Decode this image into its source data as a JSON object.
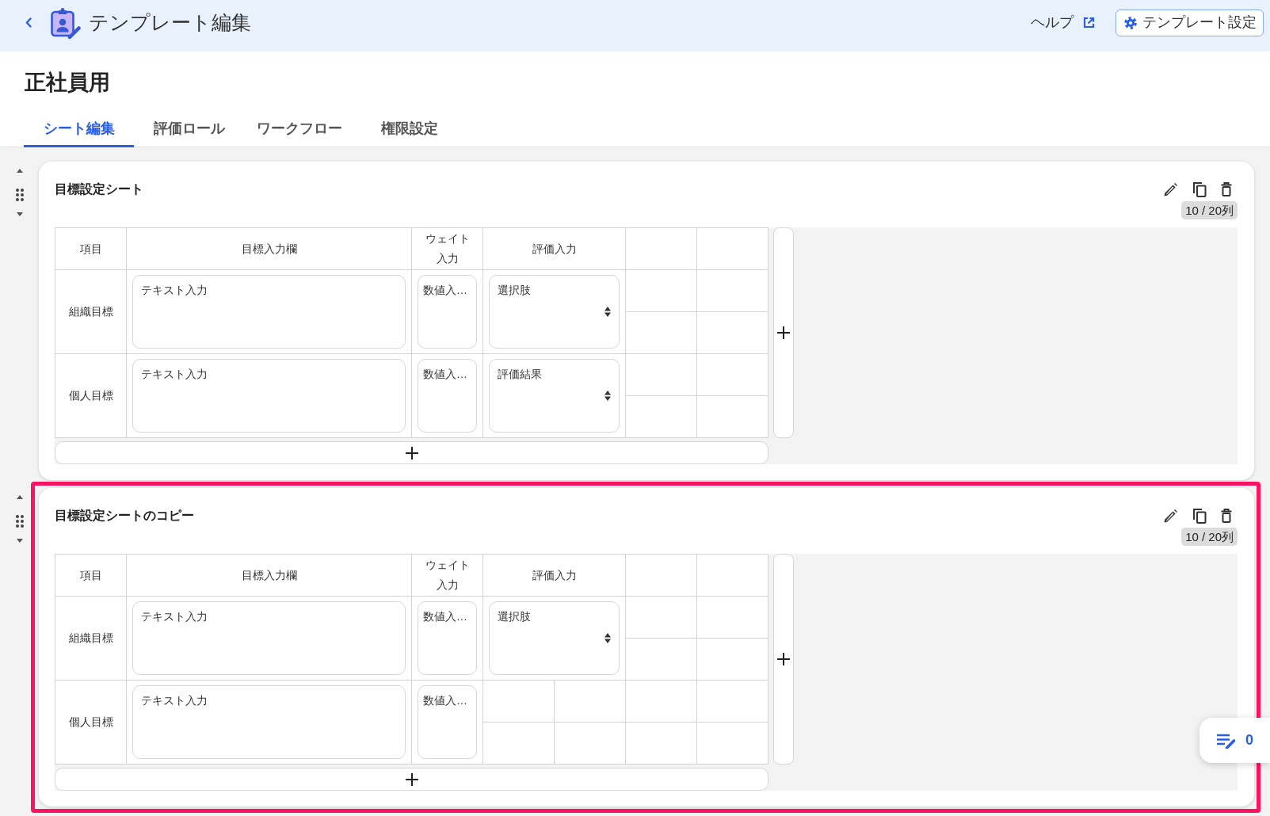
{
  "header": {
    "title": "テンプレート編集",
    "help_link": "ヘルプ",
    "settings_button": "テンプレート設定"
  },
  "page_title": "正社員用",
  "tabs": [
    {
      "label": "シート編集",
      "selected": true
    },
    {
      "label": "評価ロール",
      "selected": false
    },
    {
      "label": "ワークフロー",
      "selected": false
    },
    {
      "label": "権限設定",
      "selected": false
    }
  ],
  "sheets": [
    {
      "title": "目標設定シート",
      "selected": false,
      "column_count": "10 / 20列",
      "columns": [
        {
          "kind": "item",
          "label": "項目"
        },
        {
          "kind": "text",
          "label": "目標入力欄"
        },
        {
          "kind": "number",
          "label": "ウェイト入力"
        },
        {
          "kind": "select",
          "label": "評価入力"
        },
        {
          "kind": "blank"
        },
        {
          "kind": "blank"
        }
      ],
      "rows": [
        {
          "cells": [
            {
              "kind": "label",
              "text": "組織目標"
            },
            {
              "kind": "text",
              "placeholder": "テキスト入力"
            },
            {
              "kind": "number",
              "placeholder": "数値入…"
            },
            {
              "kind": "select",
              "value": "選択肢"
            },
            {
              "kind": "blank"
            },
            {
              "kind": "blank"
            }
          ]
        },
        {
          "cells": [
            {
              "kind": "label",
              "text": "個人目標"
            },
            {
              "kind": "text",
              "placeholder": "テキスト入力"
            },
            {
              "kind": "number",
              "placeholder": "数値入…"
            },
            {
              "kind": "select",
              "value": "評価結果"
            },
            {
              "kind": "blank"
            },
            {
              "kind": "blank"
            }
          ]
        }
      ]
    },
    {
      "title": "目標設定シートのコピー",
      "selected": true,
      "column_count": "10 / 20列",
      "columns": [
        {
          "kind": "item",
          "label": "項目"
        },
        {
          "kind": "text",
          "label": "目標入力欄"
        },
        {
          "kind": "number",
          "label": "ウェイト入力"
        },
        {
          "kind": "select",
          "label": "評価入力"
        },
        {
          "kind": "blank"
        },
        {
          "kind": "blank"
        }
      ],
      "rows": [
        {
          "cells": [
            {
              "kind": "label",
              "text": "組織目標"
            },
            {
              "kind": "text",
              "placeholder": "テキスト入力"
            },
            {
              "kind": "number",
              "placeholder": "数値入…"
            },
            {
              "kind": "select",
              "value": "選択肢"
            },
            {
              "kind": "blank"
            },
            {
              "kind": "blank"
            }
          ]
        },
        {
          "cells": [
            {
              "kind": "label",
              "text": "個人目標"
            },
            {
              "kind": "text",
              "placeholder": "テキスト入力"
            },
            {
              "kind": "number",
              "placeholder": "数値入…"
            },
            {
              "kind": "blank"
            },
            {
              "kind": "blank"
            },
            {
              "kind": "blank"
            }
          ]
        }
      ]
    }
  ],
  "floating_button": {
    "count": "0"
  }
}
